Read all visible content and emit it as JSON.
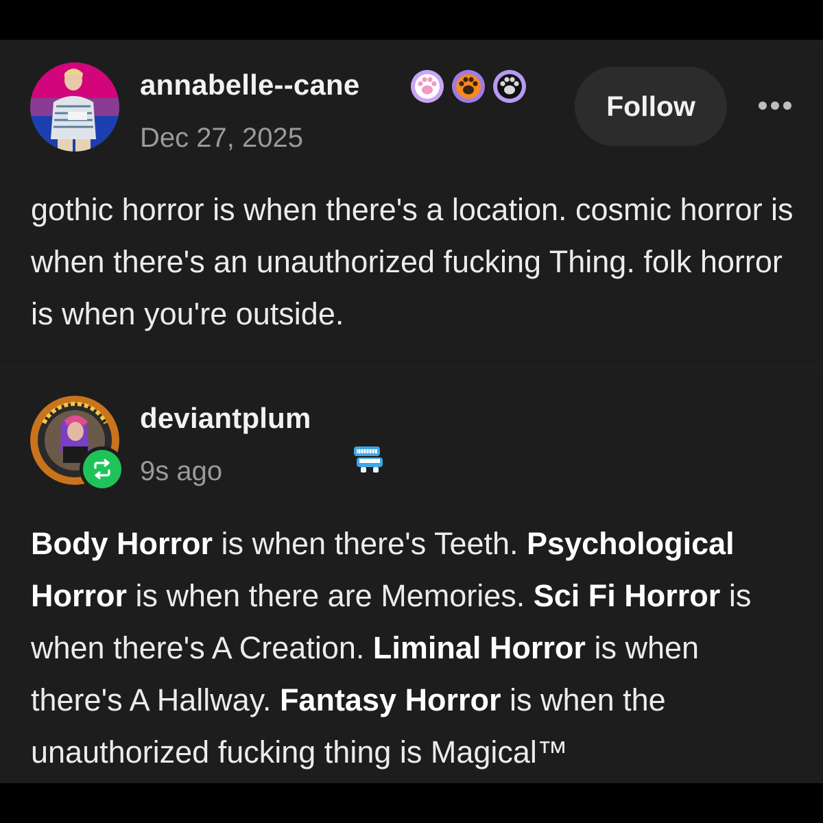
{
  "posts": [
    {
      "username": "annabelle--cane",
      "timestamp": "Dec 27, 2025",
      "badges": [
        "paw-pink-icon",
        "paw-orange-icon",
        "paw-black-icon"
      ],
      "follow_label": "Follow",
      "more_icon": "more-horizontal-icon",
      "text": "gothic horror is when there's a location. cosmic horror is when there's an unauthorized fucking Thing. folk horror is when you're outside."
    },
    {
      "username": "deviantplum",
      "timestamp": "9s ago",
      "badges": [
        "chattering-teeth-icon"
      ],
      "reblog_icon": "reblog-icon",
      "segments": [
        {
          "text": "Body Horror",
          "bold": true
        },
        {
          "text": " is when there's Teeth. ",
          "bold": false
        },
        {
          "text": "Psychological Horror",
          "bold": true
        },
        {
          "text": " is when there are Memories. ",
          "bold": false
        },
        {
          "text": "Sci Fi Horror",
          "bold": true
        },
        {
          "text": " is when there's A Creation. ",
          "bold": false
        },
        {
          "text": "Liminal Horror",
          "bold": true
        },
        {
          "text": " is when there's A Hallway. ",
          "bold": false
        },
        {
          "text": "Fantasy Horror",
          "bold": true
        },
        {
          "text": " is when the unauthorized fucking thing is Magical™",
          "bold": false
        }
      ]
    }
  ],
  "colors": {
    "background": "#1d1d1d",
    "follow_button": "#2c2c2c",
    "reblog_green": "#1fc35a",
    "timestamp_gray": "#9a9a9a"
  }
}
